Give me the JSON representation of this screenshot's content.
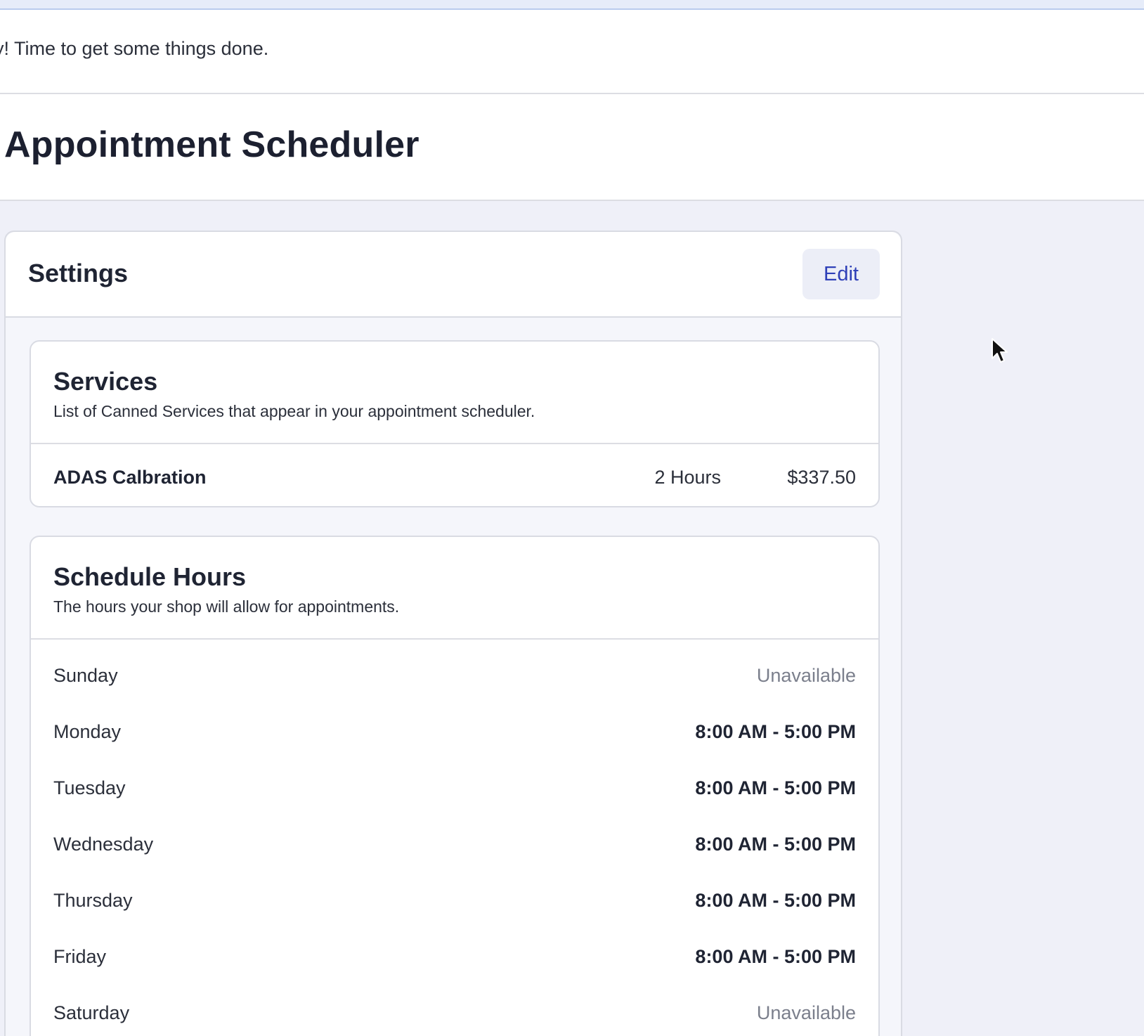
{
  "greeting": "y! Time to get some things done.",
  "page_title": "Appointment Scheduler",
  "settings": {
    "title": "Settings",
    "edit_label": "Edit"
  },
  "services": {
    "title": "Services",
    "description": "List of Canned Services that appear in your appointment scheduler.",
    "items": [
      {
        "name": "ADAS Calbration",
        "duration": "2 Hours",
        "price": "$337.50"
      }
    ]
  },
  "schedule": {
    "title": "Schedule Hours",
    "description": "The hours your shop will allow for appointments.",
    "days": [
      {
        "day": "Sunday",
        "hours": "Unavailable",
        "available": false
      },
      {
        "day": "Monday",
        "hours": "8:00 AM - 5:00 PM",
        "available": true
      },
      {
        "day": "Tuesday",
        "hours": "8:00 AM - 5:00 PM",
        "available": true
      },
      {
        "day": "Wednesday",
        "hours": "8:00 AM - 5:00 PM",
        "available": true
      },
      {
        "day": "Thursday",
        "hours": "8:00 AM - 5:00 PM",
        "available": true
      },
      {
        "day": "Friday",
        "hours": "8:00 AM - 5:00 PM",
        "available": true
      },
      {
        "day": "Saturday",
        "hours": "Unavailable",
        "available": false
      }
    ]
  },
  "colors": {
    "accent": "#2f40b8",
    "page_background": "#eff0f8",
    "muted_text": "#7b7f8c"
  }
}
